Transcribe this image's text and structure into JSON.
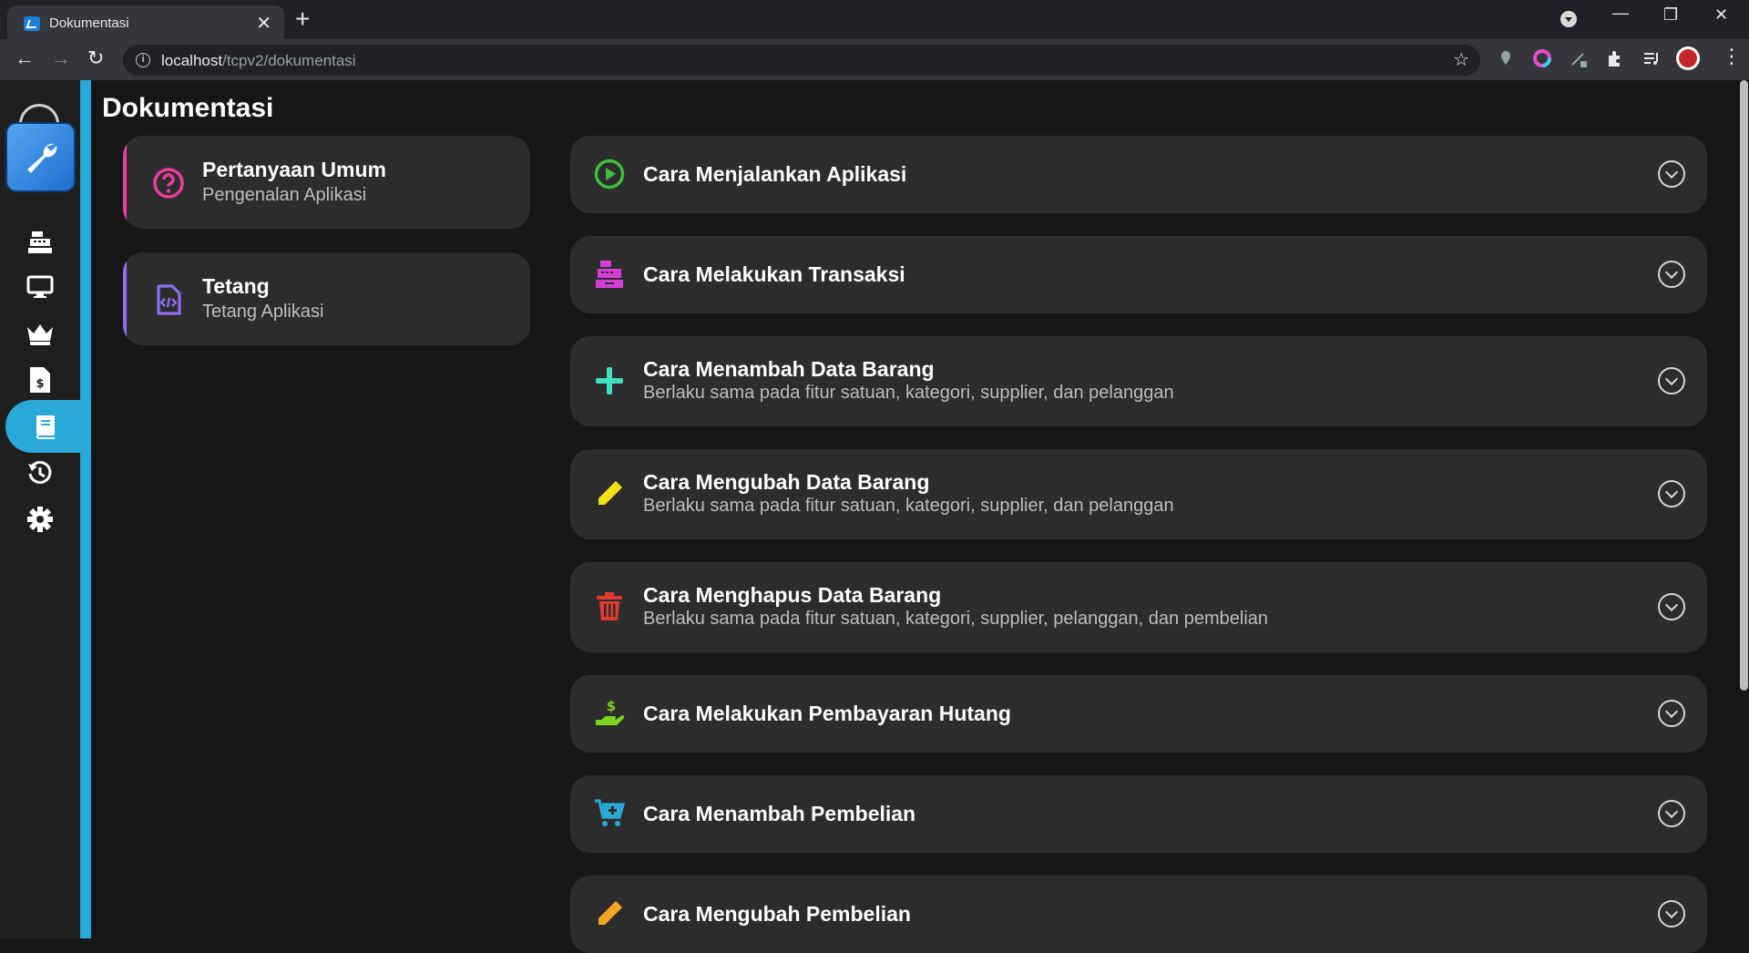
{
  "browser": {
    "tab_title": "Dokumentasi",
    "url_host": "localhost",
    "url_path": "/tcpv2/dokumentasi"
  },
  "page": {
    "title": "Dokumentasi"
  },
  "categories": [
    {
      "title": "Pertanyaan Umum",
      "subtitle": "Pengenalan Aplikasi",
      "color": "#e83e9c",
      "icon": "question-circle-icon"
    },
    {
      "title": "Tetang",
      "subtitle": "Tetang Aplikasi",
      "color": "#8b6ff0",
      "icon": "file-code-icon"
    }
  ],
  "docs": [
    {
      "title": "Cara Menjalankan Aplikasi",
      "subtitle": "",
      "color": "#3cbf3c",
      "icon": "play-circle-icon"
    },
    {
      "title": "Cara Melakukan Transaksi",
      "subtitle": "",
      "color": "#d63fd6",
      "icon": "cash-register-icon"
    },
    {
      "title": "Cara Menambah Data Barang",
      "subtitle": "Berlaku sama pada fitur satuan, kategori, supplier, dan pelanggan",
      "color": "#3ee0c0",
      "icon": "plus-icon"
    },
    {
      "title": "Cara Mengubah Data Barang",
      "subtitle": "Berlaku sama pada fitur satuan, kategori, supplier, dan pelanggan",
      "color": "#f2e21a",
      "icon": "pencil-icon"
    },
    {
      "title": "Cara Menghapus Data Barang",
      "subtitle": "Berlaku sama pada fitur satuan, kategori, supplier, pelanggan, dan pembelian",
      "color": "#e53935",
      "icon": "trash-icon"
    },
    {
      "title": "Cara Melakukan Pembayaran Hutang",
      "subtitle": "",
      "color": "#7ed321",
      "icon": "hand-holding-dollar-icon"
    },
    {
      "title": "Cara Menambah Pembelian",
      "subtitle": "",
      "color": "#2aa8d7",
      "icon": "cart-plus-icon"
    },
    {
      "title": "Cara Mengubah Pembelian",
      "subtitle": "",
      "color": "#f5a623",
      "icon": "pencil-icon"
    }
  ],
  "sidebar": {
    "items": [
      {
        "icon": "cash-register-icon"
      },
      {
        "icon": "monitor-icon"
      },
      {
        "icon": "crown-icon"
      },
      {
        "icon": "invoice-dollar-icon"
      },
      {
        "icon": "book-icon",
        "active": true
      },
      {
        "icon": "history-icon"
      },
      {
        "icon": "gear-icon"
      }
    ]
  }
}
